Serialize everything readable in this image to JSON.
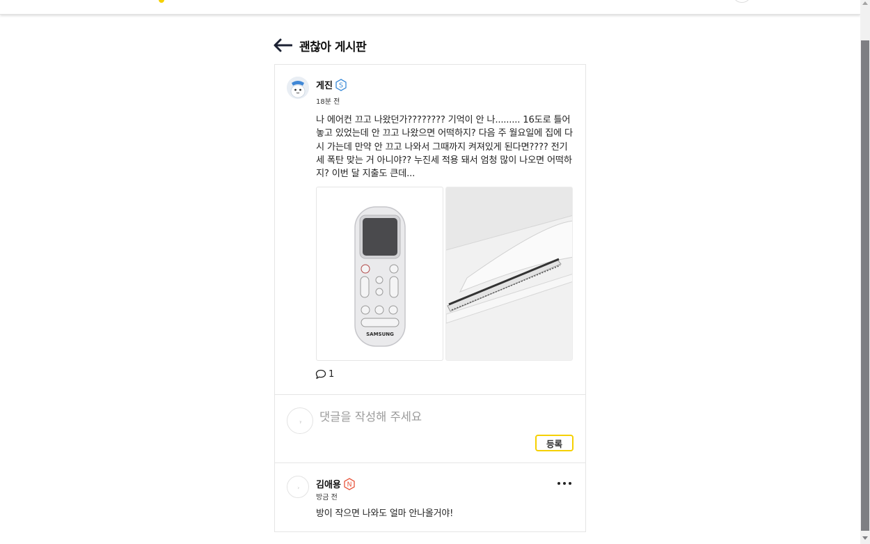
{
  "colors": {
    "accent": "#f5d000",
    "badge_s": "#3a8ad8",
    "badge_n": "#e8553c"
  },
  "header": {
    "back_icon": "arrow-left-icon",
    "title": "괜찮아 게시판"
  },
  "post": {
    "author": "게진",
    "badge": "S",
    "time": "18분 전",
    "body": "나 에어컨 끄고 나왔던가???????? 기억이 안 나......... 16도로 틀어놓고 있었는데 안 끄고 나왔으면 어떡하지? 다음 주 월요일에 집에 다시 가는데 만약 안 끄고 나와서 그때까지 켜져있게 된다면???? 전기세 폭탄 맞는 거 아니야?? 누진세 적용 돼서 엄청 많이 나오면 어떡하지? 이번 달 지출도 큰데...",
    "images": [
      "remote-control-photo",
      "air-conditioner-photo"
    ],
    "remote_brand": "SAMSUNG",
    "comment_icon": "speech-bubble-icon",
    "comment_count": "1"
  },
  "comment_form": {
    "placeholder": "댓글을 작성해 주세요",
    "submit_label": "등록"
  },
  "comments": [
    {
      "author": "김애용",
      "badge": "N",
      "time": "방금 전",
      "text": "방이 작으면 나와도 얼마 안나올거야!",
      "more_icon": "more-horizontal-icon"
    }
  ]
}
